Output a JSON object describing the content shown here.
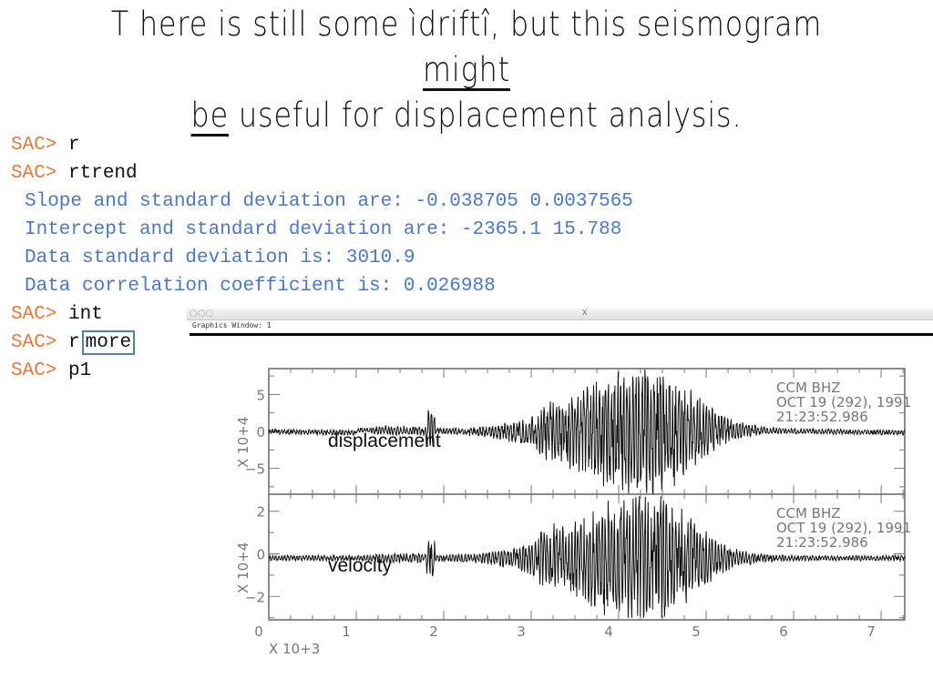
{
  "slide": {
    "title_part1": "T here is still some ìdriftî, but this seismogram ",
    "title_underlined1": "might",
    "title_underlined2": "be",
    "title_part2": " useful for displacement analysis."
  },
  "console": {
    "lines": [
      {
        "prompt": "SAC>",
        "cmd": "r"
      },
      {
        "prompt": "SAC>",
        "cmd": "rtrend"
      },
      {
        "output": "Slope and standard deviation are: -0.038705 0.0037565"
      },
      {
        "output": "Intercept and standard deviation are: -2365.1 15.788"
      },
      {
        "output": "Data standard deviation is: 3010.9"
      },
      {
        "output": "Data correlation coefficient is: 0.026988"
      },
      {
        "prompt": "SAC>",
        "cmd": "int"
      },
      {
        "prompt": "SAC>",
        "cmd": "r",
        "boxed": "more"
      },
      {
        "prompt": "SAC>",
        "cmd": "p1"
      }
    ],
    "colors": {
      "prompt": "#e8773b",
      "output": "#4a78c9",
      "box": "#4e82a8"
    }
  },
  "graphics_window": {
    "title": "Graphics Window:  1",
    "titlebar_buttons": "○○○",
    "center_icon": "X"
  },
  "chart_data": [
    {
      "type": "line",
      "name": "displacement",
      "overlay_label": "displacement",
      "xlim": [
        0,
        7.27
      ],
      "ylim": [
        -8.5,
        8.5
      ],
      "yticks": [
        5,
        0,
        -5
      ],
      "ylabel": "X 10+4",
      "annotation": [
        "CCM   BHZ",
        "OCT 19 (292), 1991",
        "21:23:52.986"
      ],
      "trace": {
        "baseline": 0,
        "event_start": 1.8,
        "peak_time": 4.3,
        "peak_amplitude": 8.0,
        "drift": true
      }
    },
    {
      "type": "line",
      "name": "velocity",
      "overlay_label": "velocity",
      "xlim": [
        0,
        7.27
      ],
      "ylim": [
        -3.1,
        2.8
      ],
      "yticks": [
        2,
        0,
        -2
      ],
      "ylabel": "X 10+4",
      "xticks": [
        0,
        1,
        2,
        3,
        4,
        5,
        6,
        7
      ],
      "xlabel": "X 10+3",
      "annotation": [
        "CCM   BHZ",
        "OCT 19 (292), 1991",
        "21:23:52.986"
      ],
      "trace": {
        "baseline": -0.2,
        "event_start": 1.8,
        "peak_time": 4.3,
        "peak_amplitude": 2.8
      }
    }
  ]
}
